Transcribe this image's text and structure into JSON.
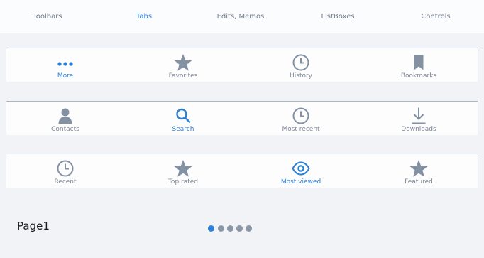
{
  "top_tabs": [
    "Toolbars",
    "Tabs",
    "Edits, Memos",
    "ListBoxes",
    "Controls"
  ],
  "tabbars": [
    {
      "items": [
        {
          "label": "More",
          "icon": "more-icon"
        },
        {
          "label": "Favorites",
          "icon": "star-icon"
        },
        {
          "label": "History",
          "icon": "clock-icon"
        },
        {
          "label": "Bookmarks",
          "icon": "bookmark-icon"
        }
      ]
    },
    {
      "items": [
        {
          "label": "Contacts",
          "icon": "contact-icon"
        },
        {
          "label": "Search",
          "icon": "search-icon"
        },
        {
          "label": "Most recent",
          "icon": "clock-icon"
        },
        {
          "label": "Downloads",
          "icon": "download-icon"
        }
      ]
    },
    {
      "items": [
        {
          "label": "Recent",
          "icon": "clock-icon"
        },
        {
          "label": "Top rated",
          "icon": "star-icon"
        },
        {
          "label": "Most viewed",
          "icon": "eye-icon"
        },
        {
          "label": "Featured",
          "icon": "star-icon"
        }
      ]
    }
  ],
  "page_label": "Page1",
  "colors": {
    "accent": "#2a7fd6",
    "icon_gray": "#8391a3",
    "label_gray": "#7d8794"
  }
}
